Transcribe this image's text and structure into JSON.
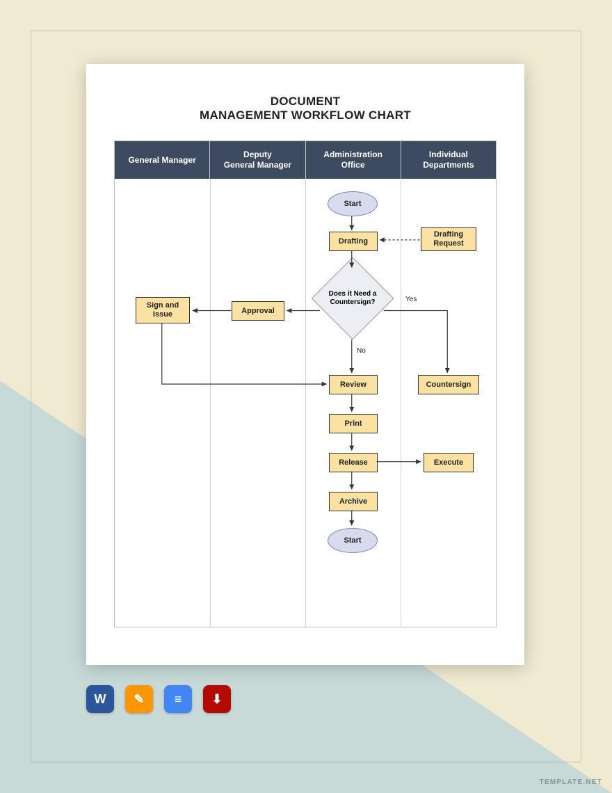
{
  "title_line1": "DOCUMENT",
  "title_line2": "MANAGEMENT WORKFLOW CHART",
  "lanes": [
    "General Manager",
    "Deputy\nGeneral Manager",
    "Administration\nOffice",
    "Individual\nDepartments"
  ],
  "nodes": {
    "start": "Start",
    "drafting": "Drafting",
    "drafting_request": "Drafting\nRequest",
    "decision": "Does it\nNeed a\nCountersign?",
    "approval": "Approval",
    "sign_issue": "Sign and\nIssue",
    "yes": "Yes",
    "no": "No",
    "countersign": "Countersign",
    "review": "Review",
    "print": "Print",
    "release": "Release",
    "execute": "Execute",
    "archive": "Archive",
    "end": "Start"
  },
  "watermark": "TEMPLATE.NET",
  "icons": {
    "word": "W",
    "pages": "✎",
    "gdoc": "≡",
    "pdf": "⬇"
  }
}
